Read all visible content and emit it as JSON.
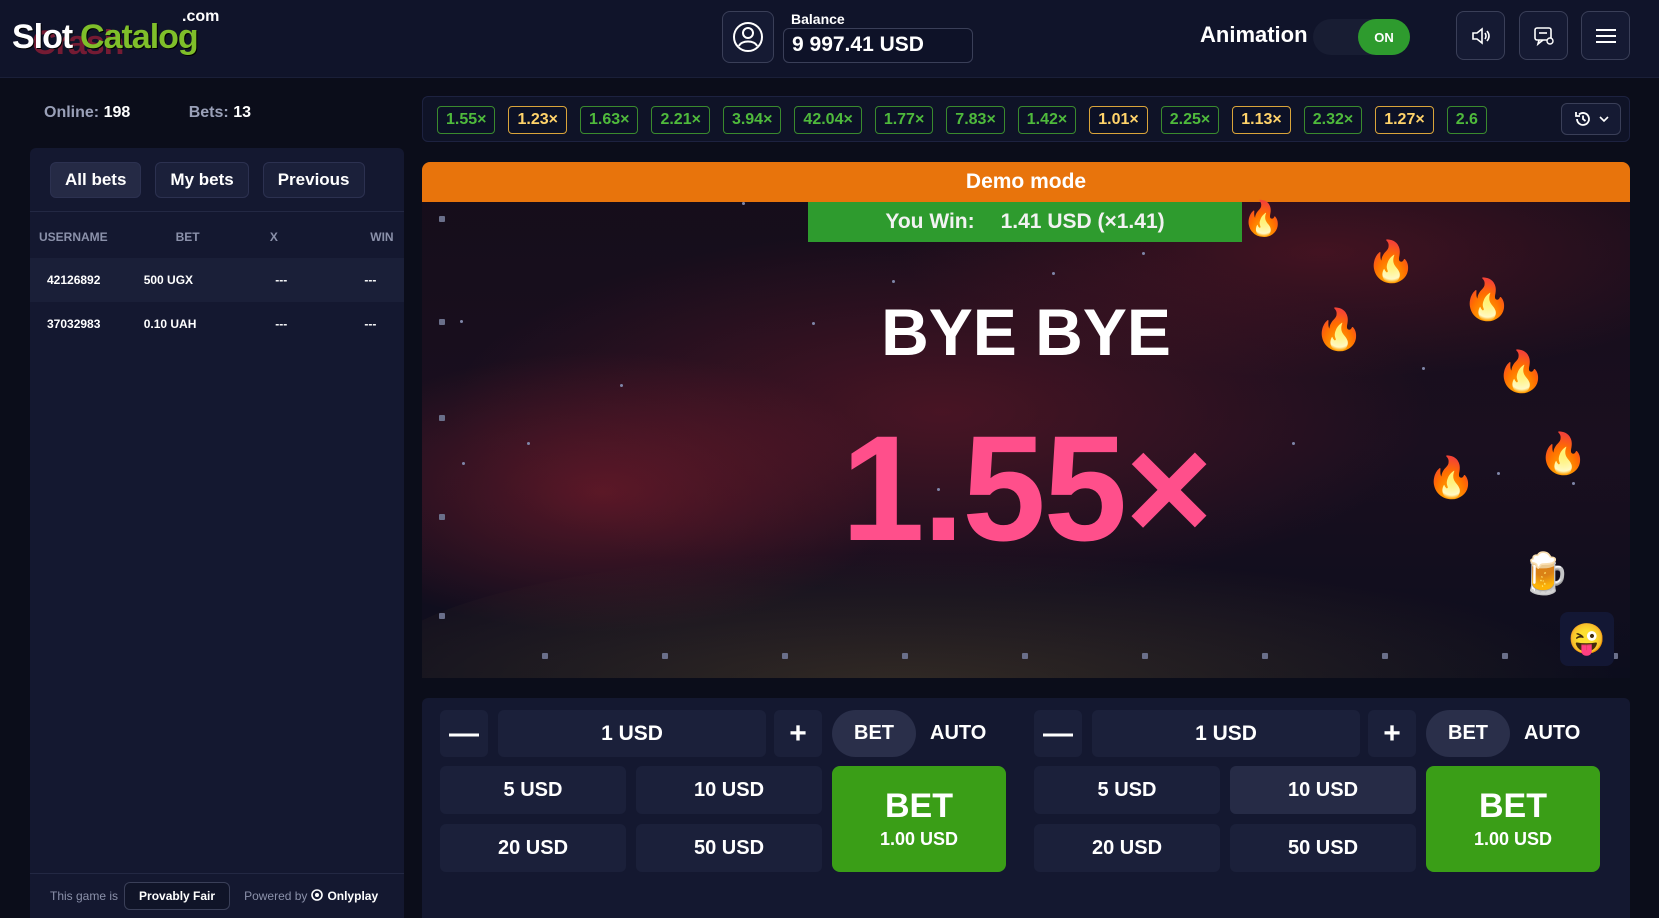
{
  "logo": {
    "part1": "Slot",
    "part2": "Catalog",
    "overlay": "Crash",
    "tld": ".com"
  },
  "header": {
    "balance_label": "Balance",
    "balance_value": "9 997.41 USD",
    "animation_label": "Animation",
    "animation_state": "ON",
    "icons": [
      "user-icon",
      "sound-icon",
      "chat-icon",
      "menu-icon"
    ]
  },
  "stats": {
    "online_label": "Online:",
    "online_value": "198",
    "bets_label": "Bets:",
    "bets_value": "13"
  },
  "bets_panel": {
    "tabs": [
      "All bets",
      "My bets",
      "Previous"
    ],
    "columns": [
      "USERNAME",
      "BET",
      "X",
      "WIN"
    ],
    "rows": [
      {
        "username": "42126892",
        "bet": "500 UGX",
        "x": "---",
        "win": "---"
      },
      {
        "username": "37032983",
        "bet": "0.10 UAH",
        "x": "---",
        "win": "---"
      }
    ],
    "footer": {
      "prefix": "This game is",
      "provably_fair": "Provably Fair",
      "powered_by": "Powered by",
      "provider": "Onlyplay"
    }
  },
  "history": {
    "items": [
      "1.55×",
      "1.23×",
      "1.63×",
      "2.21×",
      "3.94×",
      "42.04×",
      "1.77×",
      "7.83×",
      "1.42×",
      "1.01×",
      "2.25×",
      "1.13×",
      "2.32×",
      "1.27×",
      "2.6"
    ],
    "gold": [
      false,
      true,
      false,
      false,
      false,
      false,
      false,
      false,
      false,
      true,
      false,
      true,
      false,
      true,
      false
    ]
  },
  "game": {
    "demo_label": "Demo mode",
    "win_label": "You Win:",
    "win_value": "1.41 USD (×1.41)",
    "message": "BYE BYE",
    "multiplier": "1.55×",
    "emoji_button": "😜"
  },
  "bet_panels": [
    {
      "amount": "1 USD",
      "minus": "—",
      "plus": "+",
      "mode_bet": "BET",
      "mode_auto": "AUTO",
      "quick": [
        "5 USD",
        "10 USD",
        "20 USD",
        "50 USD"
      ],
      "bet_label": "BET",
      "bet_amount": "1.00 USD"
    },
    {
      "amount": "1 USD",
      "minus": "—",
      "plus": "+",
      "mode_bet": "BET",
      "mode_auto": "AUTO",
      "quick": [
        "5 USD",
        "10 USD",
        "20 USD",
        "50 USD"
      ],
      "bet_label": "BET",
      "bet_amount": "1.00 USD"
    }
  ],
  "colors": {
    "accent_green": "#3a9e17",
    "demo_orange": "#e8740c",
    "multiplier_pink": "#ff4f8b",
    "chip_green": "#4fba3c",
    "chip_gold": "#ffd36a"
  }
}
